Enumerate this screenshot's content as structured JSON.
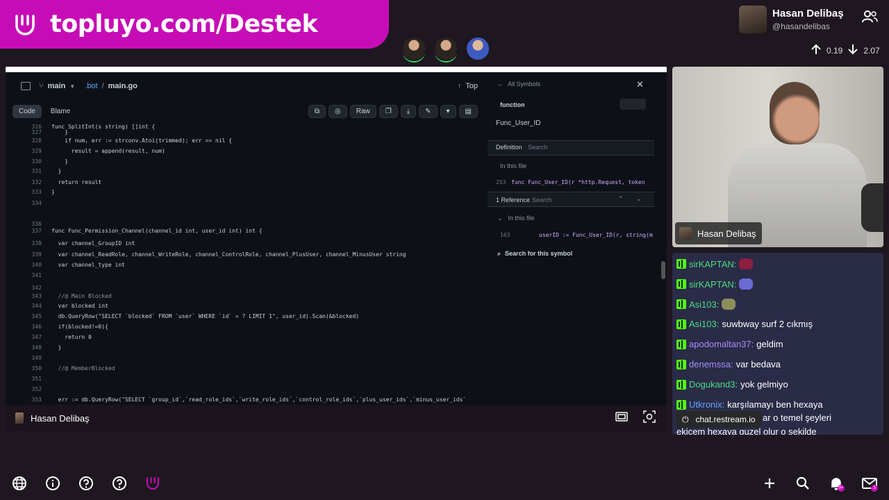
{
  "banner": {
    "url_text": "topluyo.com/Destek"
  },
  "profile": {
    "name": "Hasan Delibaş",
    "handle": "@hasandelibas"
  },
  "votes": {
    "up": "0.19",
    "down": "2.07"
  },
  "screen": {
    "branch": "main",
    "path_dir": ".bot",
    "path_sep": "/",
    "path_file": "main.go",
    "top_label": "Top",
    "tab_code": "Code",
    "tab_blame": "Blame",
    "raw_label": "Raw",
    "code_lines": [
      {
        "n": "316",
        "t": "func SplitInt(s string) []int {"
      },
      {
        "n": "327",
        "t": "    }"
      },
      {
        "n": "328",
        "t": "    if num, err := strconv.Atoi(trimmed); err == nil {"
      },
      {
        "n": "329",
        "t": "      result = append(result, num)"
      },
      {
        "n": "330",
        "t": "    }"
      },
      {
        "n": "331",
        "t": "  }"
      },
      {
        "n": "332",
        "t": "  return result"
      },
      {
        "n": "333",
        "t": "}"
      },
      {
        "n": "334",
        "t": ""
      },
      {
        "n": "336",
        "t": ""
      },
      {
        "n": "337",
        "t": "func Func_Permission_Channel(channel_id int, user_id int) int {"
      },
      {
        "n": "338",
        "t": "  var channel_GroupID int"
      },
      {
        "n": "339",
        "t": "  var channel_ReadRole, channel_WriteRole, channel_ControlRole, channel_PlusUser, channel_MinusUser string"
      },
      {
        "n": "340",
        "t": "  var channel_type int"
      },
      {
        "n": "341",
        "t": ""
      },
      {
        "n": "342",
        "t": ""
      },
      {
        "n": "343",
        "t": "  //@ Main Blocked"
      },
      {
        "n": "344",
        "t": "  var blocked int"
      },
      {
        "n": "345",
        "t": "  db.QueryRow(\"SELECT `blocked` FROM `user` WHERE `id` = ? LIMIT 1\", user_id).Scan(&blocked)"
      },
      {
        "n": "346",
        "t": "  if(blocked!=0){"
      },
      {
        "n": "347",
        "t": "    return 0"
      },
      {
        "n": "348",
        "t": "  }"
      },
      {
        "n": "349",
        "t": ""
      },
      {
        "n": "350",
        "t": "  //@ MemberBlocked"
      },
      {
        "n": "351",
        "t": ""
      },
      {
        "n": "352",
        "t": ""
      },
      {
        "n": "353",
        "t": "  err := db.QueryRow(\"SELECT `group_id`,`read_role_ids`,`write_role_ids`,`control_role_ids`,`plus_user_ids`,`minus_user_ids`"
      }
    ],
    "symbols": {
      "all_symbols": "All Symbols",
      "kind": "function",
      "name": "Func_User_ID",
      "definition": "Definition",
      "search": "Search",
      "in_this_file": "In this file",
      "def_line": "253",
      "def_code": "func Func_User_ID(r *http.Request, token",
      "ref_title": "1 Reference",
      "ref_line": "163",
      "ref_code": "userID := Func_User_ID(r, string(m",
      "search_symbol": "Search for this symbol"
    },
    "streamer_label": "Hasan Delibaş"
  },
  "cam": {
    "label": "Hasan Delibaş"
  },
  "chat": {
    "messages": [
      {
        "user": "sirKAPTAN:",
        "color": "#4ade80",
        "text": ""
      },
      {
        "user": "sirKAPTAN:",
        "color": "#4ade80",
        "text": ""
      },
      {
        "user": "Asi103:",
        "color": "#4ade80",
        "text": ""
      },
      {
        "user": "Asi103:",
        "color": "#4ade80",
        "text": "suwbway surf 2 cıkmış"
      },
      {
        "user": "apodomaltan37:",
        "color": "#a78bfa",
        "text": "geldim"
      },
      {
        "user": "denemssa:",
        "color": "#a78bfa",
        "text": "var bedava"
      },
      {
        "user": "Dogukand3:",
        "color": "#4ade80",
        "text": "yok gelmiyo"
      },
      {
        "user": "Utkronix:",
        "color": "#60a5fa",
        "text": "karşılamayı ben hexaya"
      }
    ],
    "continuation_1": "ar o temel şeyleri",
    "continuation_2": "ekicem hexaya guzel olur o sekilde",
    "watermark": "chat.restream.io"
  },
  "bottombar": {
    "globe_icon": "globe-icon",
    "info_icon": "info-icon",
    "help_icon": "help-icon",
    "notification_badge": "9+",
    "mail_badge": "3"
  }
}
